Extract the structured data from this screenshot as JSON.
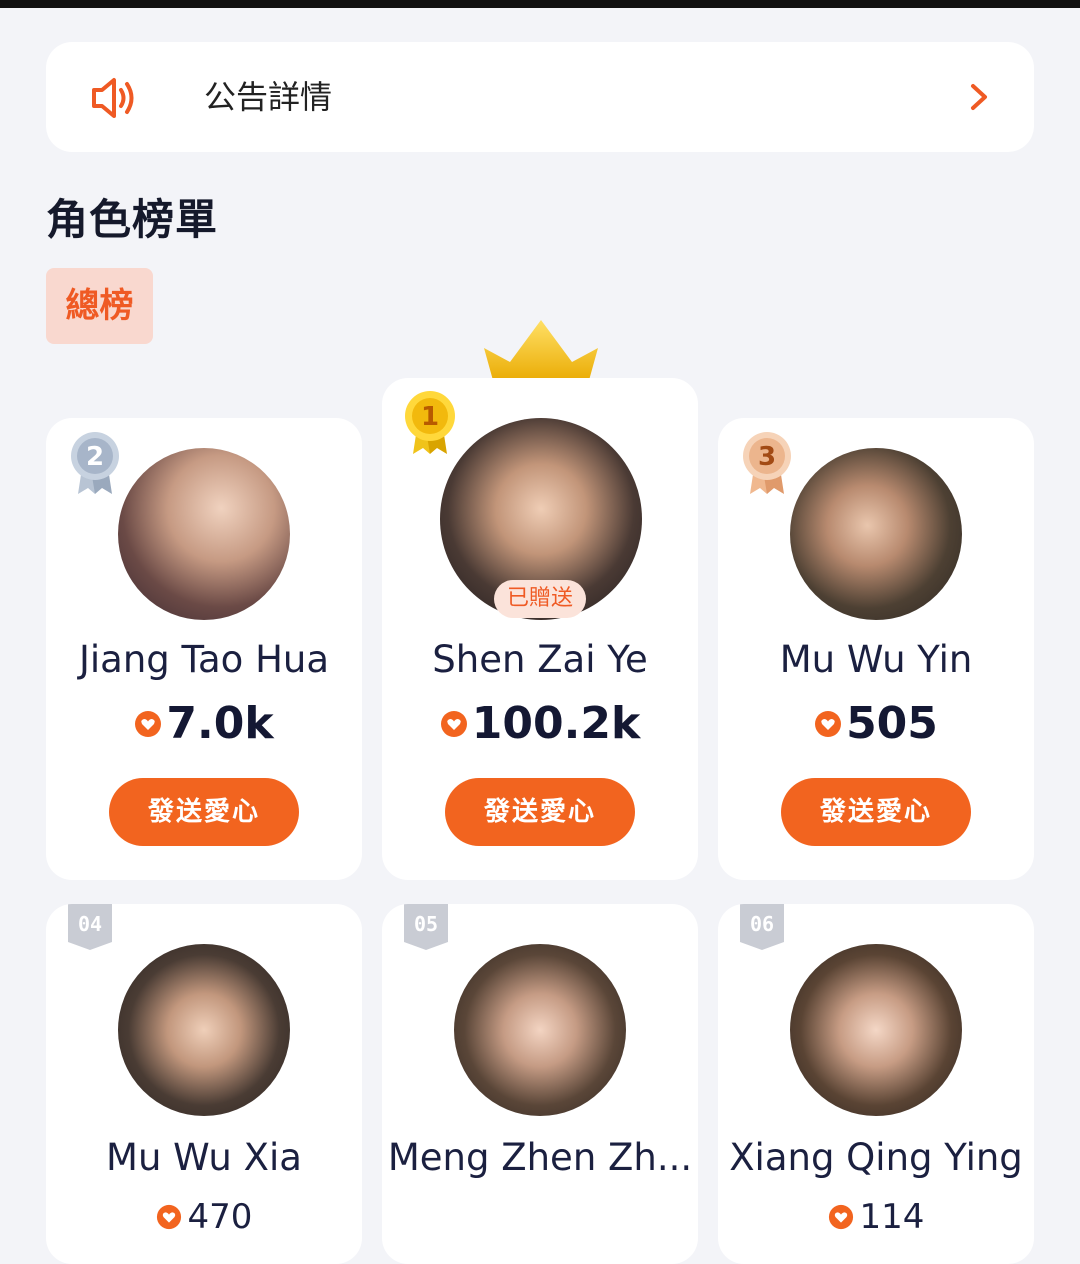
{
  "notice": {
    "text": "公告詳情",
    "icon": "speaker-icon",
    "chevron_icon": "chevron-right-icon",
    "accent": "#ef5a24"
  },
  "section": {
    "title": "角色榜單",
    "tab_label": "總榜"
  },
  "colors": {
    "accent": "#f2641f",
    "gold": "#f2b90d",
    "silver": "#a8b6c8",
    "bronze": "#e6a77c",
    "rank_flag": "#c9ccd4"
  },
  "ranking": [
    {
      "rank": "2",
      "medal": "silver-medal-icon",
      "name": "Jiang Tao Hua",
      "score": "7.0k",
      "button": "發送愛心"
    },
    {
      "rank": "1",
      "medal": "gold-medal-icon",
      "name": "Shen Zai Ye",
      "score": "100.2k",
      "button": "發送愛心",
      "sent_tag": "已贈送"
    },
    {
      "rank": "3",
      "medal": "bronze-medal-icon",
      "name": "Mu Wu Yin",
      "score": "505",
      "button": "發送愛心"
    },
    {
      "rank": "04",
      "name": "Mu Wu Xia",
      "score": "470"
    },
    {
      "rank": "05",
      "name": "Meng Zhen Zh...",
      "score": ""
    },
    {
      "rank": "06",
      "name": "Xiang Qing Ying",
      "score": "114"
    }
  ]
}
